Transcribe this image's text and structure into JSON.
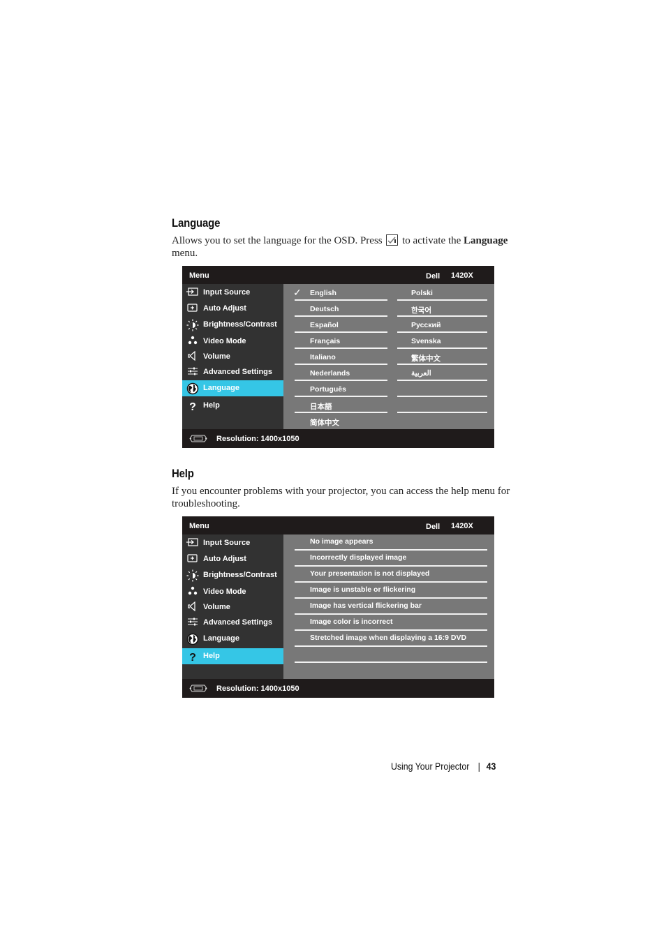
{
  "language_section": {
    "heading": "Language",
    "text_before": "Allows you to set the language for the OSD. Press",
    "key_icon": "menu-select-checkmark-icon",
    "text_after": "to activate the",
    "bold_term": "Language",
    "text_end": "menu."
  },
  "language_osd": {
    "title": "Menu",
    "brand": "Dell",
    "model": "1420X",
    "sidebar": [
      {
        "label": "Input Source",
        "icon": "input-source-icon"
      },
      {
        "label": "Auto Adjust",
        "icon": "auto-adjust-icon"
      },
      {
        "label": "Brightness/Contrast",
        "icon": "brightness-icon"
      },
      {
        "label": "Video Mode",
        "icon": "video-mode-icon"
      },
      {
        "label": "Volume",
        "icon": "volume-icon"
      },
      {
        "label": "Advanced Settings",
        "icon": "advanced-settings-icon"
      },
      {
        "label": "Language",
        "icon": "globe-icon",
        "active": true
      },
      {
        "label": "Help",
        "icon": "help-icon"
      }
    ],
    "languages_col1": [
      "English",
      "Deutsch",
      "Español",
      "Français",
      "Italiano",
      "Nederlands",
      "Português",
      "日本語",
      "简体中文"
    ],
    "languages_col2": [
      "Polski",
      "한국어",
      "Русский",
      "Svenska",
      "繁体中文",
      "العربية"
    ],
    "selected_language": "English",
    "status": "Resolution: 1400x1050",
    "status_icon": "vga-connector-icon"
  },
  "help_section": {
    "heading": "Help",
    "text": "If you encounter problems with your projector, you can access the help menu for troubleshooting."
  },
  "help_osd": {
    "title": "Menu",
    "brand": "Dell",
    "model": "1420X",
    "sidebar": [
      {
        "label": "Input Source",
        "icon": "input-source-icon"
      },
      {
        "label": "Auto Adjust",
        "icon": "auto-adjust-icon"
      },
      {
        "label": "Brightness/Contrast",
        "icon": "brightness-icon"
      },
      {
        "label": "Video Mode",
        "icon": "video-mode-icon"
      },
      {
        "label": "Volume",
        "icon": "volume-icon"
      },
      {
        "label": "Advanced Settings",
        "icon": "advanced-settings-icon"
      },
      {
        "label": "Language",
        "icon": "globe-icon"
      },
      {
        "label": "Help",
        "icon": "help-icon",
        "active": true
      }
    ],
    "topics": [
      "No image appears",
      "Incorrectly displayed image",
      "Your presentation is not displayed",
      "Image is unstable or flickering",
      "Image has vertical flickering bar",
      "Image color is incorrect",
      "Stretched image when displaying a 16:9 DVD"
    ],
    "status": "Resolution: 1400x1050",
    "status_icon": "vga-connector-icon"
  },
  "footer": {
    "section": "Using Your Projector",
    "page": "43"
  }
}
